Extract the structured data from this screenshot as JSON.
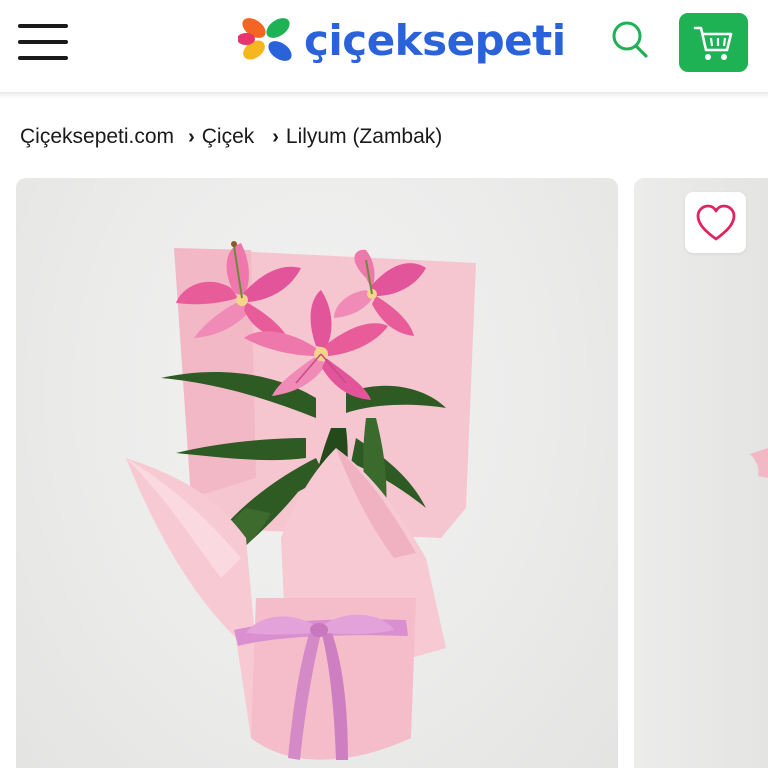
{
  "header": {
    "logo_text": "çiçeksepeti",
    "menu_icon": "hamburger-menu-icon",
    "search_icon": "search-icon",
    "cart_icon": "cart-icon",
    "cart_color": "#1fb255",
    "logo_color": "#2a62d9"
  },
  "breadcrumb": [
    {
      "label": "Çiçeksepeti.com"
    },
    {
      "label": "Çiçek"
    },
    {
      "label": "Lilyum (Zambak)"
    }
  ],
  "product": {
    "image_alt": "Pink lily bouquet wrapped in pink paper with satin ribbon",
    "favorite_icon": "heart-icon",
    "favorite_color": "#e0245e"
  }
}
